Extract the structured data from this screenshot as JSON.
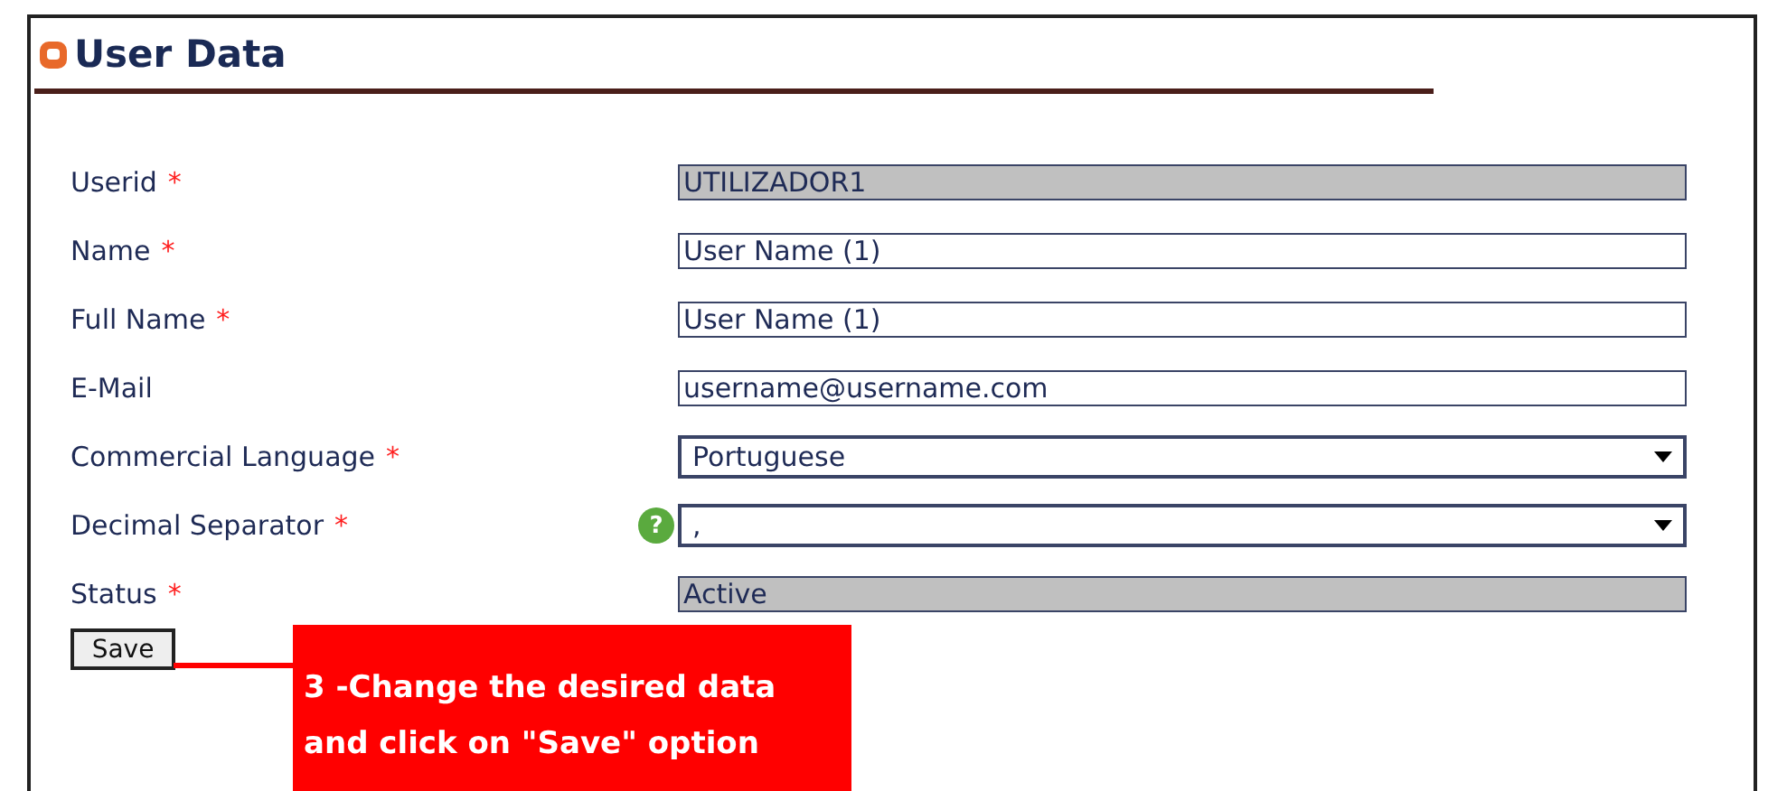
{
  "title": "User Data",
  "fields": [
    {
      "label": "Userid",
      "required_mark": "*",
      "kind": "text",
      "value": "UTILIZADOR1",
      "disabled": true
    },
    {
      "label": "Name",
      "required_mark": "*",
      "kind": "text",
      "value": "User Name (1)",
      "disabled": false
    },
    {
      "label": "Full Name",
      "required_mark": "*",
      "kind": "text",
      "value": "User Name (1)",
      "disabled": false
    },
    {
      "label": "E-Mail",
      "kind": "text",
      "value": "username@username.com",
      "disabled": false
    },
    {
      "label": "Commercial Language",
      "required_mark": "*",
      "kind": "select",
      "value": "Portuguese",
      "disabled": false
    },
    {
      "label": "Decimal Separator",
      "required_mark": "*",
      "kind": "select",
      "value": ",",
      "disabled": false,
      "help": "?"
    },
    {
      "label": "Status",
      "required_mark": "*",
      "kind": "text",
      "value": "Active",
      "disabled": true
    }
  ],
  "save_button": "Save",
  "callout": {
    "lines": [
      "3 -Change the desired data",
      "and click on \"Save\" option"
    ]
  }
}
